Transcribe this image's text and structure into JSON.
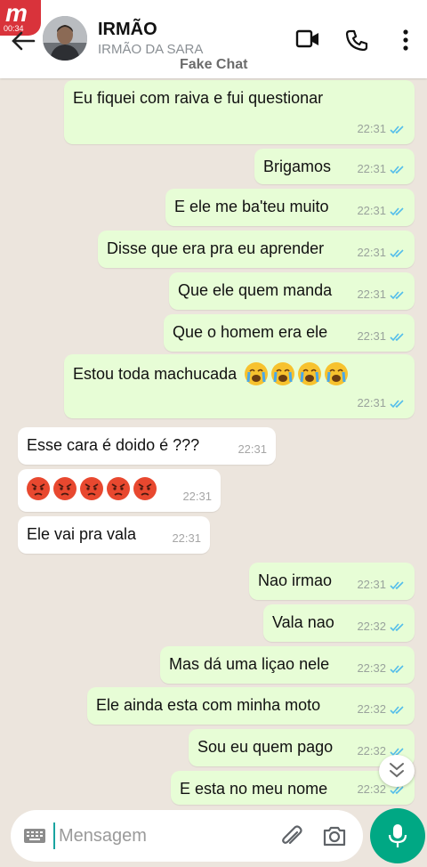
{
  "header": {
    "app_badge": "m",
    "app_badge_time": "00:34",
    "contact_name": "IRMÃO",
    "contact_subtitle": "IRMÃO DA SARA",
    "watermark": "Fake Chat"
  },
  "messages": [
    {
      "direction": "out",
      "text": "Eu fiquei com raiva e fui questionar",
      "time": "22:31",
      "status": "read"
    },
    {
      "direction": "out",
      "text": "Brigamos",
      "time": "22:31",
      "status": "read"
    },
    {
      "direction": "out",
      "text": "E ele me ba'teu muito",
      "time": "22:31",
      "status": "read"
    },
    {
      "direction": "out",
      "text": "Disse que era pra eu aprender",
      "time": "22:31",
      "status": "read"
    },
    {
      "direction": "out",
      "text": "Que ele quem manda",
      "time": "22:31",
      "status": "read"
    },
    {
      "direction": "out",
      "text": "Que o homem era ele",
      "time": "22:31",
      "status": "read"
    },
    {
      "direction": "out",
      "text": "Estou toda machucada",
      "emoji": "loudly-crying-face x4",
      "time": "22:31",
      "status": "read"
    },
    {
      "direction": "in",
      "text": "Esse cara é doido é ???",
      "time": "22:31"
    },
    {
      "direction": "in",
      "text": "",
      "emoji": "pouting-face x5",
      "time": "22:31"
    },
    {
      "direction": "in",
      "text": "Ele vai pra vala",
      "time": "22:31"
    },
    {
      "direction": "out",
      "text": "Nao irmao",
      "time": "22:31",
      "status": "read"
    },
    {
      "direction": "out",
      "text": "Vala nao",
      "time": "22:32",
      "status": "read"
    },
    {
      "direction": "out",
      "text": "Mas dá uma liçao nele",
      "time": "22:32",
      "status": "read"
    },
    {
      "direction": "out",
      "text": "Ele ainda esta com minha moto",
      "time": "22:32",
      "status": "read"
    },
    {
      "direction": "out",
      "text": "Sou eu quem pago",
      "time": "22:32",
      "status": "read"
    },
    {
      "direction": "out",
      "text": "E esta no meu nome",
      "time": "22:32",
      "status": "read"
    }
  ],
  "composer": {
    "placeholder": "Mensagem"
  },
  "colors": {
    "outgoing_bubble": "#e7fdd6",
    "incoming_bubble": "#ffffff",
    "chat_background": "#ece5dd",
    "read_tick": "#53bdeb",
    "mic_button": "#00a884"
  },
  "icons": [
    "back-arrow-icon",
    "video-call-icon",
    "phone-icon",
    "more-vert-icon",
    "keyboard-icon",
    "paperclip-icon",
    "camera-icon",
    "mic-icon",
    "double-chevron-down-icon"
  ]
}
